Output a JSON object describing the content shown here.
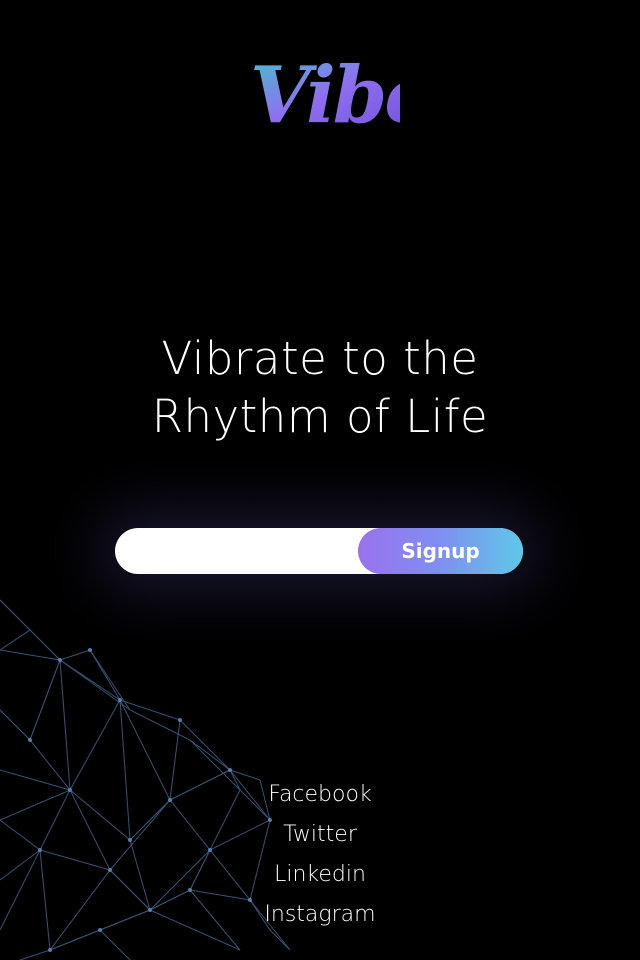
{
  "brand": {
    "logo_text": "Vibe",
    "colors": [
      "#3fc7c9",
      "#8f6ff0",
      "#6b4ed6"
    ]
  },
  "hero": {
    "headline_line1": "Vibrate to the",
    "headline_line2": "Rhythm of Life"
  },
  "signup": {
    "email_value": "",
    "button_label": "Signup",
    "button_gradient": [
      "#9a72ee",
      "#5ec8e8"
    ]
  },
  "social": {
    "links": [
      {
        "label": "Facebook"
      },
      {
        "label": "Twitter"
      },
      {
        "label": "Linkedin"
      },
      {
        "label": "Instagram"
      }
    ]
  },
  "theme": {
    "background": "#000000",
    "text": "#ffffff",
    "mesh_color": "#4a6f9a"
  }
}
